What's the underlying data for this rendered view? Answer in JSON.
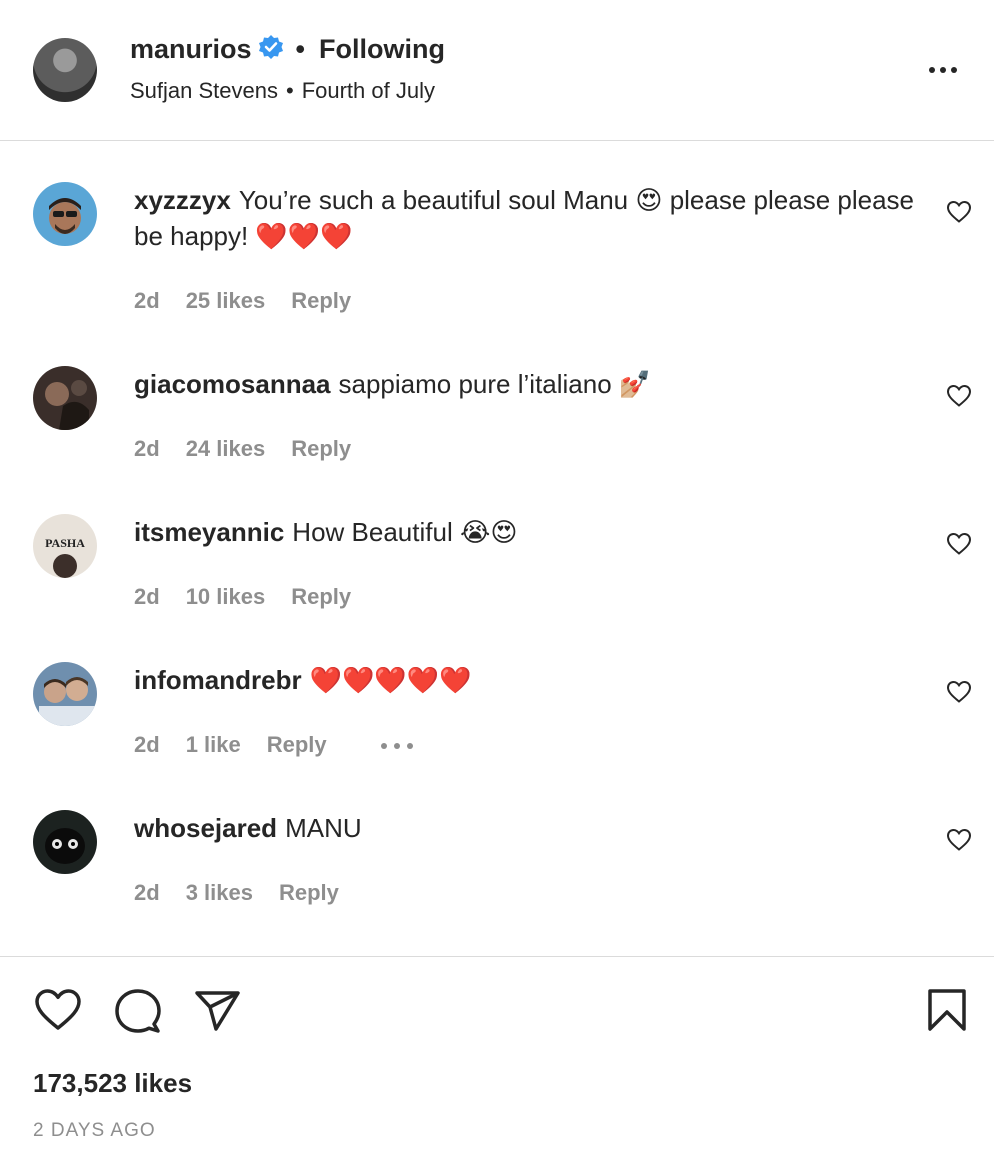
{
  "header": {
    "username": "manurios",
    "follow_status": "Following",
    "audio_artist": "Sufjan Stevens",
    "audio_title": "Fourth of July"
  },
  "comments": [
    {
      "username": "xyzzzyx",
      "text": "You’re such a beautiful soul Manu 😍 please please please be happy! ❤️❤️❤️",
      "time": "2d",
      "likes": "25 likes",
      "reply": "Reply"
    },
    {
      "username": "giacomosannaa",
      "text": "sappiamo pure l’italiano 💅🏼",
      "time": "2d",
      "likes": "24 likes",
      "reply": "Reply"
    },
    {
      "username": "itsmeyannic",
      "text": "How Beautiful 😭😍",
      "time": "2d",
      "likes": "10 likes",
      "reply": "Reply",
      "avatar_text": "PASHA"
    },
    {
      "username": "infomandrebr",
      "text": "❤️❤️❤️❤️❤️",
      "time": "2d",
      "likes": "1 like",
      "reply": "Reply"
    },
    {
      "username": "whosejared",
      "text": "MANU",
      "time": "2d",
      "likes": "3 likes",
      "reply": "Reply"
    }
  ],
  "footer": {
    "likes_total": "173,523 likes",
    "time_ago": "2 DAYS AGO"
  },
  "icons": {
    "verified": "verified-badge-icon",
    "more": "more-options-icon",
    "comment_like": "heart-outline-icon",
    "like": "heart-icon",
    "comment": "comment-bubble-icon",
    "share": "paper-plane-icon",
    "save": "bookmark-icon"
  },
  "colors": {
    "verified_blue": "#3897f0",
    "text": "#262626",
    "secondary": "#8e8e8e",
    "divider": "#dbdbdb"
  }
}
